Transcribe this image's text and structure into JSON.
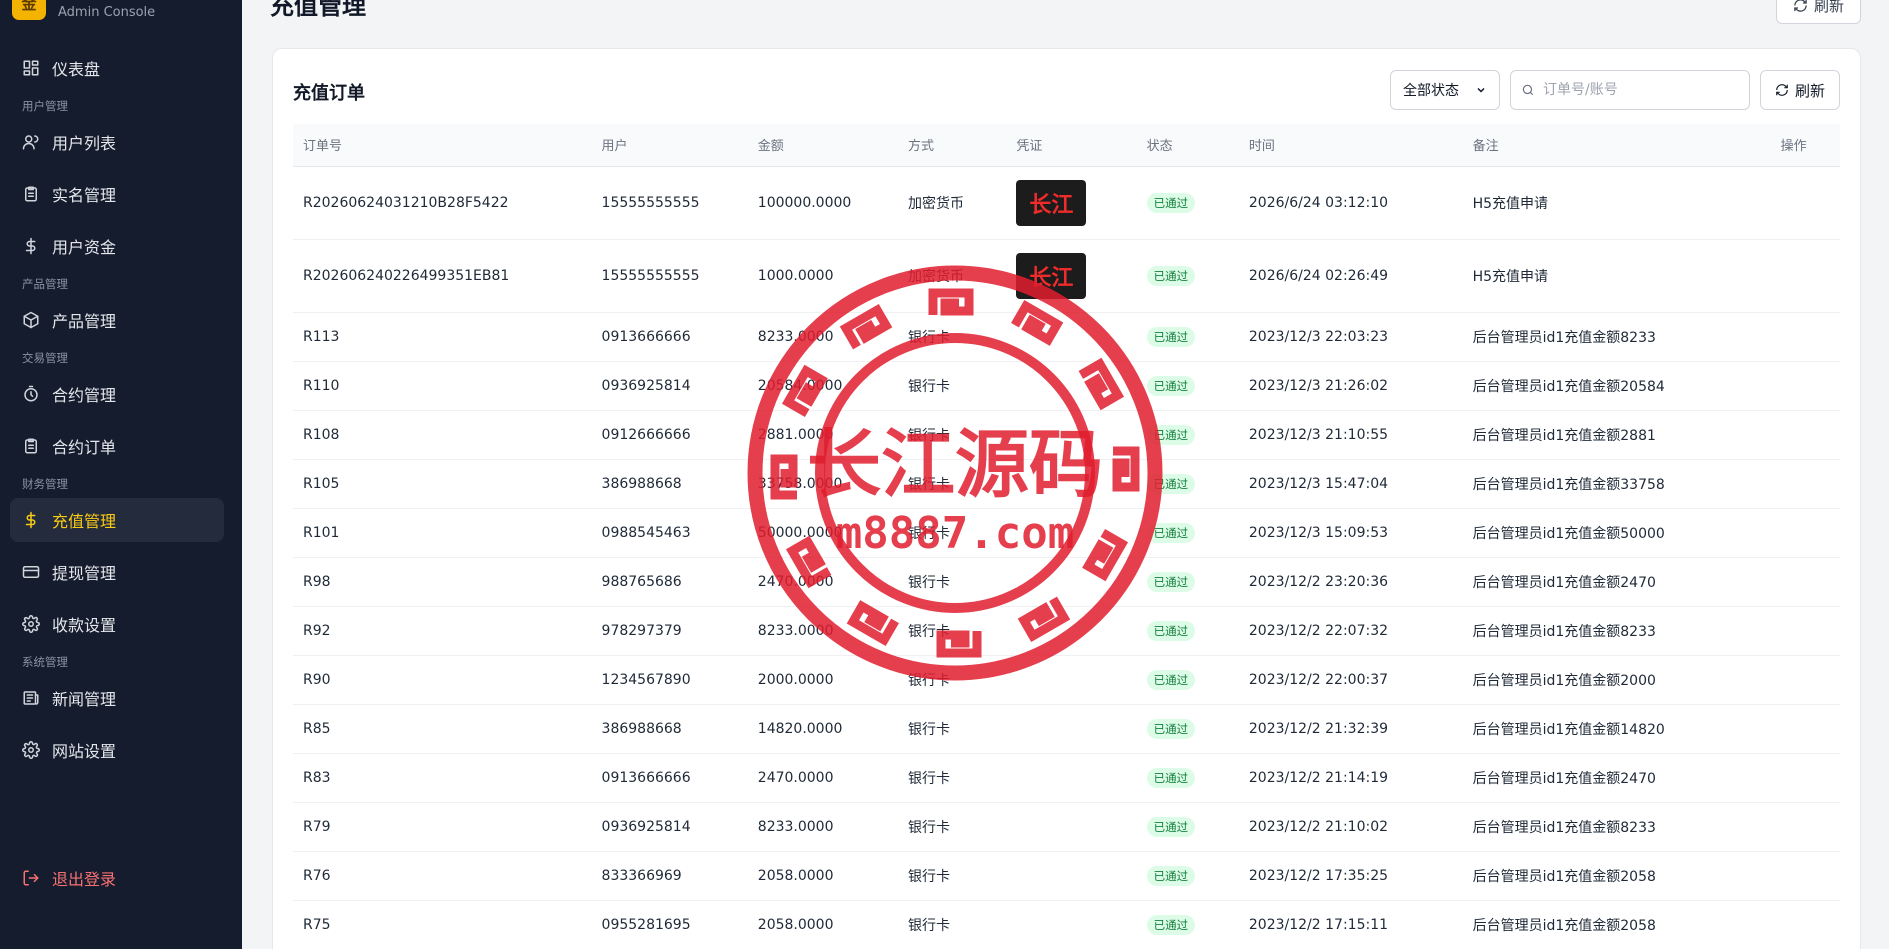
{
  "brand": {
    "logo_char": "金",
    "subtitle": "Admin Console"
  },
  "sidebar": {
    "items": [
      {
        "type": "item",
        "label": "仪表盘",
        "icon": "dashboard-icon"
      },
      {
        "type": "group",
        "label": "用户管理"
      },
      {
        "type": "item",
        "label": "用户列表",
        "icon": "users-icon"
      },
      {
        "type": "item",
        "label": "实名管理",
        "icon": "clipboard-icon"
      },
      {
        "type": "item",
        "label": "用户资金",
        "icon": "dollar-icon"
      },
      {
        "type": "group",
        "label": "产品管理"
      },
      {
        "type": "item",
        "label": "产品管理",
        "icon": "box-icon"
      },
      {
        "type": "group",
        "label": "交易管理"
      },
      {
        "type": "item",
        "label": "合约管理",
        "icon": "timer-icon"
      },
      {
        "type": "item",
        "label": "合约订单",
        "icon": "clipboard-icon"
      },
      {
        "type": "group",
        "label": "财务管理"
      },
      {
        "type": "item",
        "label": "充值管理",
        "icon": "dollar-icon",
        "active": true
      },
      {
        "type": "item",
        "label": "提现管理",
        "icon": "card-icon"
      },
      {
        "type": "item",
        "label": "收款设置",
        "icon": "gear-icon"
      },
      {
        "type": "group",
        "label": "系统管理"
      },
      {
        "type": "item",
        "label": "新闻管理",
        "icon": "news-icon"
      },
      {
        "type": "item",
        "label": "网站设置",
        "icon": "gear-icon"
      }
    ],
    "logout_label": "退出登录"
  },
  "header": {
    "title": "充值管理",
    "refresh_label": "刷新"
  },
  "card": {
    "title": "充值订单",
    "status_filter": "全部状态",
    "search_placeholder": "订单号/账号",
    "refresh_label": "刷新"
  },
  "table": {
    "columns": [
      "订单号",
      "用户",
      "金额",
      "方式",
      "凭证",
      "状态",
      "时间",
      "备注",
      "操作"
    ],
    "rows": [
      {
        "order": "R20260624031210B28F5422",
        "user": "15555555555",
        "amount": "100000.0000",
        "method": "加密货币",
        "voucher": "长江",
        "status": "已通过",
        "time": "2026/6/24 03:12:10",
        "note": "H5充值申请"
      },
      {
        "order": "R202606240226499351EB81",
        "user": "15555555555",
        "amount": "1000.0000",
        "method": "加密货币",
        "voucher": "长江",
        "status": "已通过",
        "time": "2026/6/24 02:26:49",
        "note": "H5充值申请"
      },
      {
        "order": "R113",
        "user": "0913666666",
        "amount": "8233.0000",
        "method": "银行卡",
        "voucher": "",
        "status": "已通过",
        "time": "2023/12/3 22:03:23",
        "note": "后台管理员id1充值金额8233"
      },
      {
        "order": "R110",
        "user": "0936925814",
        "amount": "20584.0000",
        "method": "银行卡",
        "voucher": "",
        "status": "已通过",
        "time": "2023/12/3 21:26:02",
        "note": "后台管理员id1充值金额20584"
      },
      {
        "order": "R108",
        "user": "0912666666",
        "amount": "2881.0000",
        "method": "银行卡",
        "voucher": "",
        "status": "已通过",
        "time": "2023/12/3 21:10:55",
        "note": "后台管理员id1充值金额2881"
      },
      {
        "order": "R105",
        "user": "386988668",
        "amount": "33758.0000",
        "method": "银行卡",
        "voucher": "",
        "status": "已通过",
        "time": "2023/12/3 15:47:04",
        "note": "后台管理员id1充值金额33758"
      },
      {
        "order": "R101",
        "user": "0988545463",
        "amount": "50000.0000",
        "method": "银行卡",
        "voucher": "",
        "status": "已通过",
        "time": "2023/12/3 15:09:53",
        "note": "后台管理员id1充值金额50000"
      },
      {
        "order": "R98",
        "user": "988765686",
        "amount": "2470.0000",
        "method": "银行卡",
        "voucher": "",
        "status": "已通过",
        "time": "2023/12/2 23:20:36",
        "note": "后台管理员id1充值金额2470"
      },
      {
        "order": "R92",
        "user": "978297379",
        "amount": "8233.0000",
        "method": "银行卡",
        "voucher": "",
        "status": "已通过",
        "time": "2023/12/2 22:07:32",
        "note": "后台管理员id1充值金额8233"
      },
      {
        "order": "R90",
        "user": "1234567890",
        "amount": "2000.0000",
        "method": "银行卡",
        "voucher": "",
        "status": "已通过",
        "time": "2023/12/2 22:00:37",
        "note": "后台管理员id1充值金额2000"
      },
      {
        "order": "R85",
        "user": "386988668",
        "amount": "14820.0000",
        "method": "银行卡",
        "voucher": "",
        "status": "已通过",
        "time": "2023/12/2 21:32:39",
        "note": "后台管理员id1充值金额14820"
      },
      {
        "order": "R83",
        "user": "0913666666",
        "amount": "2470.0000",
        "method": "银行卡",
        "voucher": "",
        "status": "已通过",
        "time": "2023/12/2 21:14:19",
        "note": "后台管理员id1充值金额2470"
      },
      {
        "order": "R79",
        "user": "0936925814",
        "amount": "8233.0000",
        "method": "银行卡",
        "voucher": "",
        "status": "已通过",
        "time": "2023/12/2 21:10:02",
        "note": "后台管理员id1充值金额8233"
      },
      {
        "order": "R76",
        "user": "833366969",
        "amount": "2058.0000",
        "method": "银行卡",
        "voucher": "",
        "status": "已通过",
        "time": "2023/12/2 17:35:25",
        "note": "后台管理员id1充值金额2058"
      },
      {
        "order": "R75",
        "user": "0955281695",
        "amount": "2058.0000",
        "method": "银行卡",
        "voucher": "",
        "status": "已通过",
        "time": "2023/12/2 17:15:11",
        "note": "后台管理员id1充值金额2058"
      }
    ]
  },
  "watermark": {
    "title": "长江源码",
    "domain": "m8887.com"
  },
  "colors": {
    "sidebar_bg": "#141c2e",
    "active_text": "#facc15",
    "success_bg": "#dcfce7",
    "success_text": "#15803d",
    "logout": "#f87171",
    "watermark": "#e11d2e"
  }
}
